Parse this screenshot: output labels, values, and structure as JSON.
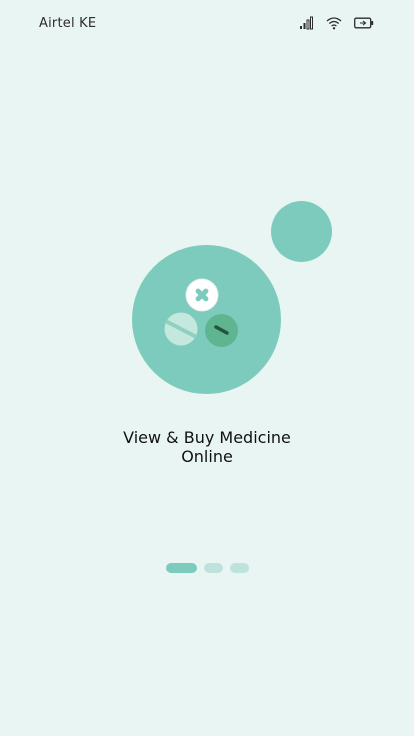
{
  "status_bar": {
    "carrier": "Airtel KE",
    "icons": [
      "signal-icon",
      "wifi-icon",
      "battery-icon"
    ]
  },
  "onboarding": {
    "title_line1": "View & Buy Medicine",
    "title_line2": "Online",
    "pages_total": 3,
    "current_page": 1
  },
  "colors": {
    "background": "#e9f5f2",
    "accent": "#7ccbbc",
    "dot_inactive": "#bfe3dc"
  }
}
